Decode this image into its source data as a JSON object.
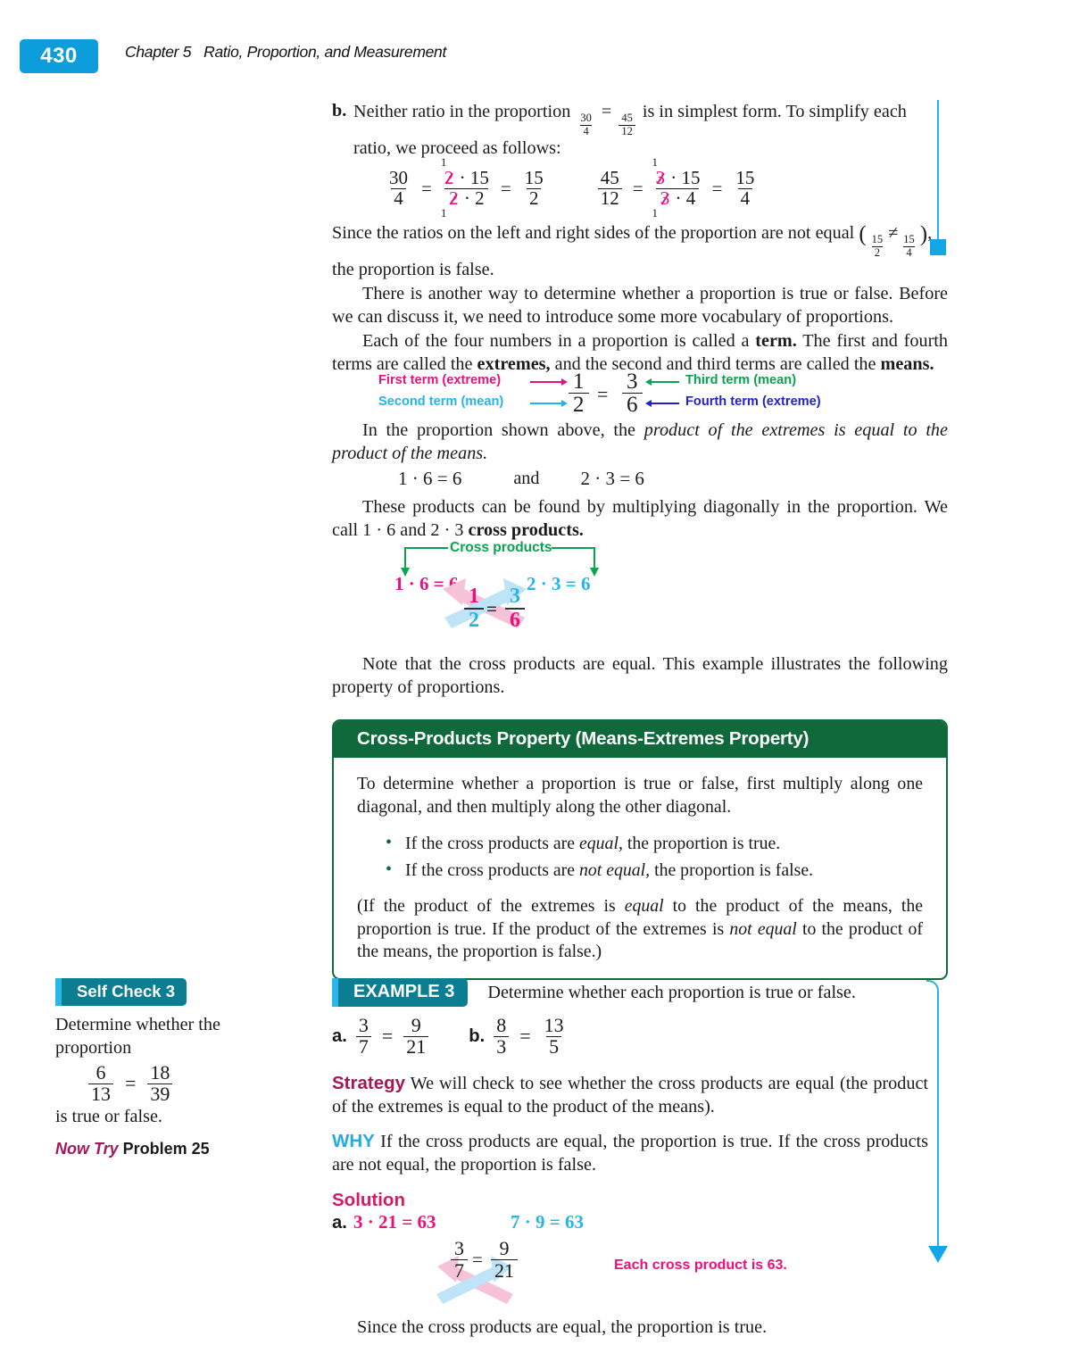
{
  "header": {
    "page_number": "430",
    "chapter": "Chapter 5",
    "chapter_title": "Ratio, Proportion, and Measurement"
  },
  "part_b": {
    "label": "b.",
    "line1_pre": "Neither ratio in the proportion",
    "prop_left_num": "30",
    "prop_left_den": "4",
    "equals": "=",
    "prop_right_num": "45",
    "prop_right_den": "12",
    "line1_post": "is in simplest form. To simplify each",
    "line2": "ratio, we proceed as follows:"
  },
  "work": {
    "left": {
      "f1_num": "30",
      "f1_den": "4",
      "eq1": "=",
      "f2_num_a": "2",
      "f2_num_dot": "·",
      "f2_num_b": "15",
      "f2_den_a": "2",
      "f2_den_dot": "·",
      "f2_den_b": "2",
      "sup_top": "1",
      "sup_bot": "1",
      "eq2": "=",
      "f3_num": "15",
      "f3_den": "2"
    },
    "right": {
      "f1_num": "45",
      "f1_den": "12",
      "eq1": "=",
      "f2_num_a": "3",
      "f2_num_dot": "·",
      "f2_num_b": "15",
      "f2_den_a": "3",
      "f2_den_dot": "·",
      "f2_den_b": "4",
      "sup_top": "1",
      "sup_bot": "1",
      "eq2": "=",
      "f3_num": "15",
      "f3_den": "4"
    }
  },
  "since_paragraph": {
    "pre": "Since the ratios on the left and right sides of the proportion are not equal",
    "paren_open": "(",
    "a_num": "15",
    "a_den": "2",
    "neq": "≠",
    "b_num": "15",
    "b_den": "4",
    "paren_close": ")",
    "comma": ",",
    "line2": "the proportion is false."
  },
  "paragraphs": {
    "another_way": "There is another way to determine whether a proportion is true or false. Before we can discuss it, we need to introduce some more vocabulary of proportions.",
    "each_four_pre": "Each of the four numbers in a proportion is called a ",
    "each_four_b1": "term.",
    "each_four_mid": " The first and fourth terms are called the ",
    "each_four_b2": "extremes,",
    "each_four_mid2": " and the second and third terms are called the ",
    "each_four_b3": "means.",
    "in_the_proportion_pre": "In the proportion shown above, the ",
    "in_the_proportion_ital": "product of the extremes is equal to the product of the means.",
    "these_products_pre": "These products can be found by multiplying diagonally in the proportion. We call 1 · 6 and 2 · 3 ",
    "these_products_bold": "cross products.",
    "note_that": "Note that the cross products are equal. This example illustrates the following property of proportions."
  },
  "terms_diagram": {
    "first_term": "First term (extreme)",
    "second_term": "Second term (mean)",
    "third_term": "Third term (mean)",
    "fourth_term": "Fourth term (extreme)",
    "frac_left_num": "1",
    "frac_left_den": "2",
    "equals": "=",
    "frac_right_num": "3",
    "frac_right_den": "6",
    "color_first": "#e8117f",
    "color_second": "#25b4ea",
    "color_third": "#0aa34f",
    "color_fourth": "#2222c9"
  },
  "products_line": {
    "left": "1 · 6 = 6",
    "and": "and",
    "right": "2 · 3 = 6"
  },
  "cross_diagram_1": {
    "caption": "Cross products",
    "left_product": "1 · 6 = 6",
    "right_product": "2 · 3 = 6",
    "frac_left_num": "1",
    "frac_left_den": "2",
    "equals": "=",
    "frac_right_num": "3",
    "frac_right_den": "6",
    "color_magenta": "#e8117f",
    "color_cyan": "#25b4ea",
    "color_green": "#0aa34f",
    "arrow_pink": "#f8c3d8",
    "arrow_blue": "#bfe3f7"
  },
  "property_box": {
    "title": "Cross-Products Property (Means-Extremes Property)",
    "intro": "To determine whether a proportion is true or false, first multiply along one diagonal, and then multiply along the other diagonal.",
    "bullets": [
      {
        "pre": "If the cross products are ",
        "ital": "equal,",
        "post": " the proportion is true."
      },
      {
        "pre": "If the cross products are ",
        "ital": "not equal,",
        "post": " the proportion is false."
      }
    ],
    "closing_1": "(If the product of the extremes is ",
    "closing_i1": "equal",
    "closing_2": " to the product of the means, the proportion is true. If the product of the extremes is ",
    "closing_i2": "not equal",
    "closing_3": " to the product of the means, the proportion is false.)",
    "header_color": "#10693a"
  },
  "self_check": {
    "badge": "Self Check 3",
    "line1": "Determine whether the",
    "line2": "proportion",
    "frac_left_num": "6",
    "frac_left_den": "13",
    "equals": "=",
    "frac_right_num": "18",
    "frac_right_den": "39",
    "line3": "is true or false.",
    "now_try": "Now Try",
    "problem": "Problem 25",
    "badge_color": "#0b7e91",
    "badge_accent": "#29b6e8"
  },
  "example": {
    "badge": "EXAMPLE 3",
    "lead": "Determine whether each proportion is true or false.",
    "items": [
      {
        "label": "a.",
        "num1": "3",
        "den1": "7",
        "eq": "=",
        "num2": "9",
        "den2": "21"
      },
      {
        "label": "b.",
        "num1": "8",
        "den1": "3",
        "eq": "=",
        "num2": "13",
        "den2": "5"
      }
    ],
    "strategy_label": "Strategy",
    "strategy_text": "We will check to see whether the cross products are equal (the product of the extremes is equal to the product of the means).",
    "why_label": "WHY",
    "why_text": "If the cross products are equal, the proportion is true. If the cross products are not equal, the proportion is false.",
    "solution_label": "Solution",
    "solution_a": {
      "label": "a.",
      "left_product": "3 · 21 = 63",
      "right_product": "7 · 9 = 63",
      "frac_left_num": "3",
      "frac_left_den": "7",
      "equals": "=",
      "frac_right_num": "9",
      "frac_right_den": "21",
      "annotation": "Each cross product is 63."
    },
    "conclusion": "Since the cross products are equal, the proportion is true."
  },
  "colors": {
    "page_tab": "#0d9ddb",
    "rule_blue": "#25b4ea",
    "magenta": "#e8117f",
    "cyan": "#25b4ea",
    "green": "#0aa34f",
    "blue": "#2222c9",
    "teal": "#0b7e91",
    "strategy": "#a3175c",
    "why": "#25aae1",
    "solution": "#d31b67"
  }
}
